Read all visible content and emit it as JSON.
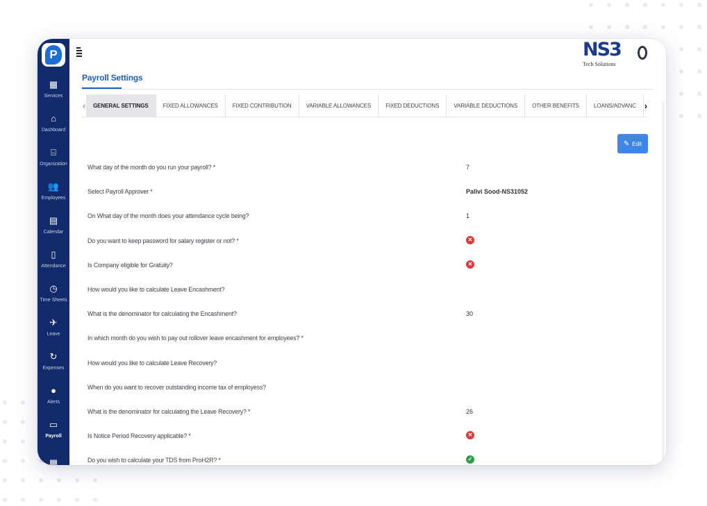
{
  "sidebar": {
    "items": [
      {
        "label": "Services",
        "icon": "grid-icon",
        "glyph": "▦"
      },
      {
        "label": "Dashboard",
        "icon": "home-icon",
        "glyph": "⌂"
      },
      {
        "label": "Organization",
        "icon": "bank-icon",
        "glyph": "⌸"
      },
      {
        "label": "Employees",
        "icon": "users-icon",
        "glyph": "👥"
      },
      {
        "label": "Calendar",
        "icon": "calendar-icon",
        "glyph": "▤"
      },
      {
        "label": "Attendance",
        "icon": "clipboard-icon",
        "glyph": "▯"
      },
      {
        "label": "Time Sheets",
        "icon": "clock-icon",
        "glyph": "◷"
      },
      {
        "label": "Leave",
        "icon": "plane-icon",
        "glyph": "✈"
      },
      {
        "label": "Expenses",
        "icon": "refresh-icon",
        "glyph": "↻"
      },
      {
        "label": "Alerts",
        "icon": "alert-icon",
        "glyph": "●"
      },
      {
        "label": "Payroll",
        "icon": "wallet-icon",
        "glyph": "▭"
      },
      {
        "label": "",
        "icon": "calculator-icon",
        "glyph": "▦"
      }
    ]
  },
  "header": {
    "brand_mark": "NS3",
    "brand_sub": "Tech Solutions"
  },
  "page": {
    "title": "Payroll Settings",
    "edit_label": "Edit"
  },
  "tabs": [
    {
      "label": "GENERAL SETTINGS",
      "active": true
    },
    {
      "label": "FIXED ALLOWANCES",
      "active": false
    },
    {
      "label": "FIXED CONTRIBUTION",
      "active": false
    },
    {
      "label": "VARIABLE ALLOWANCES",
      "active": false
    },
    {
      "label": "FIXED DEDUCTIONS",
      "active": false
    },
    {
      "label": "VARIABLE DEDUCTIONS",
      "active": false
    },
    {
      "label": "OTHER BENEFITS",
      "active": false
    },
    {
      "label": "LOANS/ADVANC",
      "active": false
    }
  ],
  "settings": [
    {
      "q": "What day of the month do you run your payroll? *",
      "a": "7",
      "type": "text"
    },
    {
      "q": "Select Payroll Approver *",
      "a": "Pallvi Sood-NS31052",
      "type": "strong"
    },
    {
      "q": "On What day of the month does your attendance cycle being?",
      "a": "1",
      "type": "text"
    },
    {
      "q": "Do you want to keep password for salary register or not? *",
      "a": "",
      "type": "no"
    },
    {
      "q": "Is Company eligible for Gratuity?",
      "a": "",
      "type": "no"
    },
    {
      "q": "How would you like to calculate Leave Encashment?",
      "a": "",
      "type": "text"
    },
    {
      "q": "What is the denominator for calculating the Encashment?",
      "a": "30",
      "type": "text"
    },
    {
      "q": "In which month do you wish to pay out rollover leave encashment for employees? *",
      "a": "",
      "type": "text"
    },
    {
      "q": "How would you like to calculate Leave Recovery?",
      "a": "",
      "type": "text"
    },
    {
      "q": "When do you want to recover outstanding income tax of employess?",
      "a": "",
      "type": "text"
    },
    {
      "q": "What is the denominator for calculating the Leave Recovery? *",
      "a": "26",
      "type": "text"
    },
    {
      "q": "Is Notice Period Recovery applicable? *",
      "a": "",
      "type": "no"
    },
    {
      "q": "Do you wish to calculate your TDS from ProH2R? *",
      "a": "",
      "type": "yes"
    }
  ],
  "colors": {
    "sidebar": "#102a6b",
    "accent": "#1f5fb8",
    "edit_button": "#3f86e6",
    "status_no": "#dd3b3b",
    "status_yes": "#2e9e4a"
  }
}
